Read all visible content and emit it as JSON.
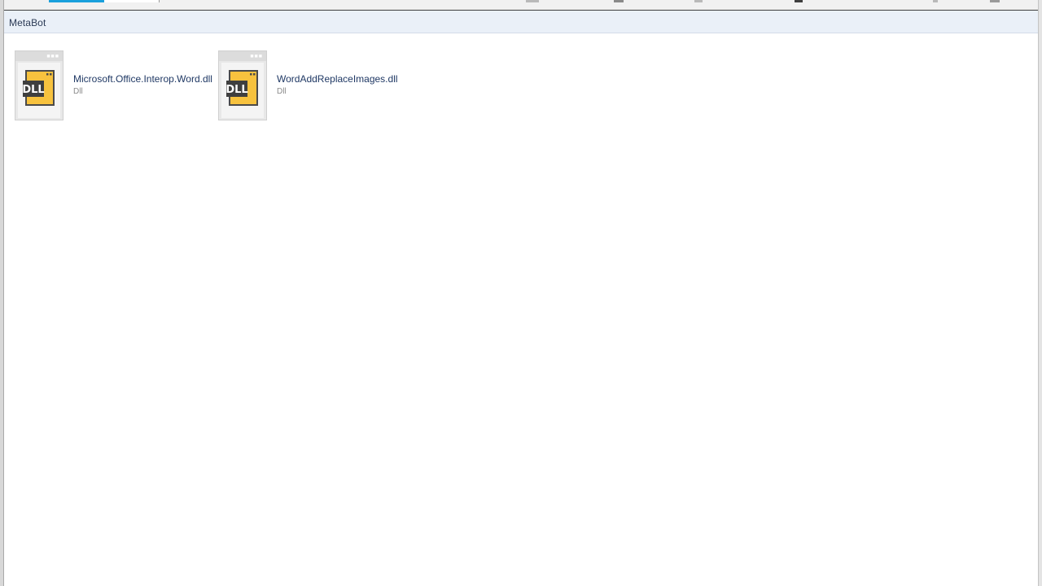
{
  "breadcrumb": {
    "label": "MetaBot"
  },
  "files": [
    {
      "name": "Microsoft.Office.Interop.Word.dll",
      "type": "Dll",
      "icon": "dll-file-icon",
      "icon_label": "DLL"
    },
    {
      "name": "WordAddReplaceImages.dll",
      "type": "Dll",
      "icon": "dll-file-icon",
      "icon_label": "DLL"
    }
  ],
  "colors": {
    "accent": "#1aa0dc",
    "breadcrumb_bg": "#eaf0f8",
    "file_name": "#1f3864",
    "icon_fill": "#f7c23e",
    "icon_dark": "#4a4a4a"
  }
}
